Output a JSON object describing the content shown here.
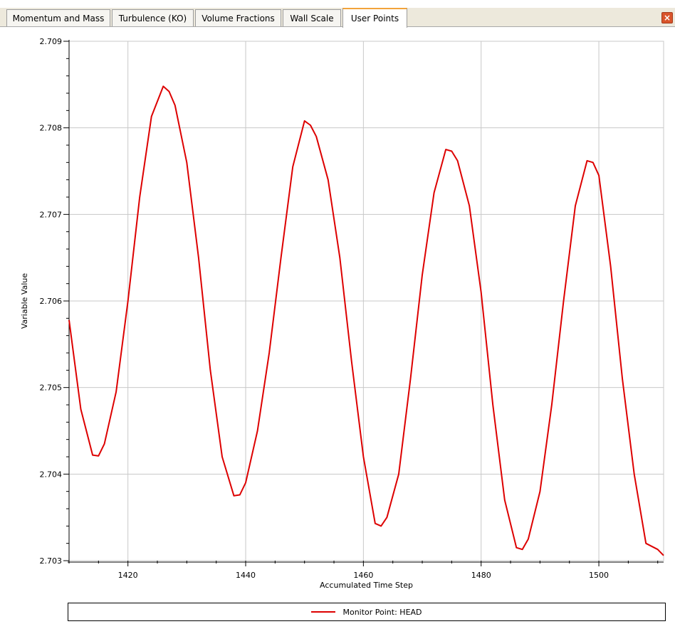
{
  "tabs": [
    {
      "label": "Momentum and Mass",
      "active": false
    },
    {
      "label": "Turbulence (KO)",
      "active": false
    },
    {
      "label": "Volume Fractions",
      "active": false
    },
    {
      "label": "Wall Scale",
      "active": false
    },
    {
      "label": "User Points",
      "active": true
    }
  ],
  "close_label": "x",
  "colors": {
    "series": "#dd0000",
    "active_tab_accent": "#f2a33a"
  },
  "chart_data": {
    "type": "line",
    "title": "",
    "xlabel": "Accumulated Time Step",
    "ylabel": "Variable Value",
    "xlim": [
      1410,
      1511
    ],
    "ylim": [
      2.703,
      2.709
    ],
    "x_ticks": [
      1420,
      1440,
      1460,
      1480,
      1500
    ],
    "y_ticks": [
      2.703,
      2.704,
      2.705,
      2.706,
      2.707,
      2.708,
      2.709
    ],
    "grid": true,
    "legend_position": "bottom",
    "series": [
      {
        "name": "Monitor Point: HEAD",
        "color": "#dd0000",
        "x": [
          1410,
          1412,
          1414,
          1415,
          1416,
          1418,
          1420,
          1422,
          1424,
          1426,
          1427,
          1428,
          1430,
          1432,
          1434,
          1436,
          1438,
          1439,
          1440,
          1442,
          1444,
          1446,
          1448,
          1450,
          1451,
          1452,
          1454,
          1456,
          1458,
          1460,
          1462,
          1463,
          1464,
          1466,
          1468,
          1470,
          1472,
          1474,
          1475,
          1476,
          1478,
          1480,
          1482,
          1484,
          1486,
          1487,
          1488,
          1490,
          1492,
          1494,
          1496,
          1498,
          1499,
          1500,
          1502,
          1504,
          1506,
          1508,
          1510,
          1511
        ],
        "y": [
          2.70578,
          2.70475,
          2.70422,
          2.70421,
          2.70435,
          2.70495,
          2.706,
          2.7072,
          2.70813,
          2.70848,
          2.70842,
          2.70826,
          2.7076,
          2.7065,
          2.7052,
          2.7042,
          2.70375,
          2.70376,
          2.7039,
          2.7045,
          2.7054,
          2.7065,
          2.70755,
          2.70808,
          2.70803,
          2.7079,
          2.7074,
          2.7065,
          2.7053,
          2.7042,
          2.70343,
          2.7034,
          2.7035,
          2.704,
          2.7051,
          2.7063,
          2.70725,
          2.70775,
          2.70773,
          2.70762,
          2.7071,
          2.7061,
          2.7048,
          2.7037,
          2.70315,
          2.70313,
          2.70325,
          2.7038,
          2.7048,
          2.706,
          2.7071,
          2.70762,
          2.7076,
          2.70745,
          2.7064,
          2.7051,
          2.704,
          2.7032,
          2.70313,
          2.70306
        ]
      }
    ]
  }
}
